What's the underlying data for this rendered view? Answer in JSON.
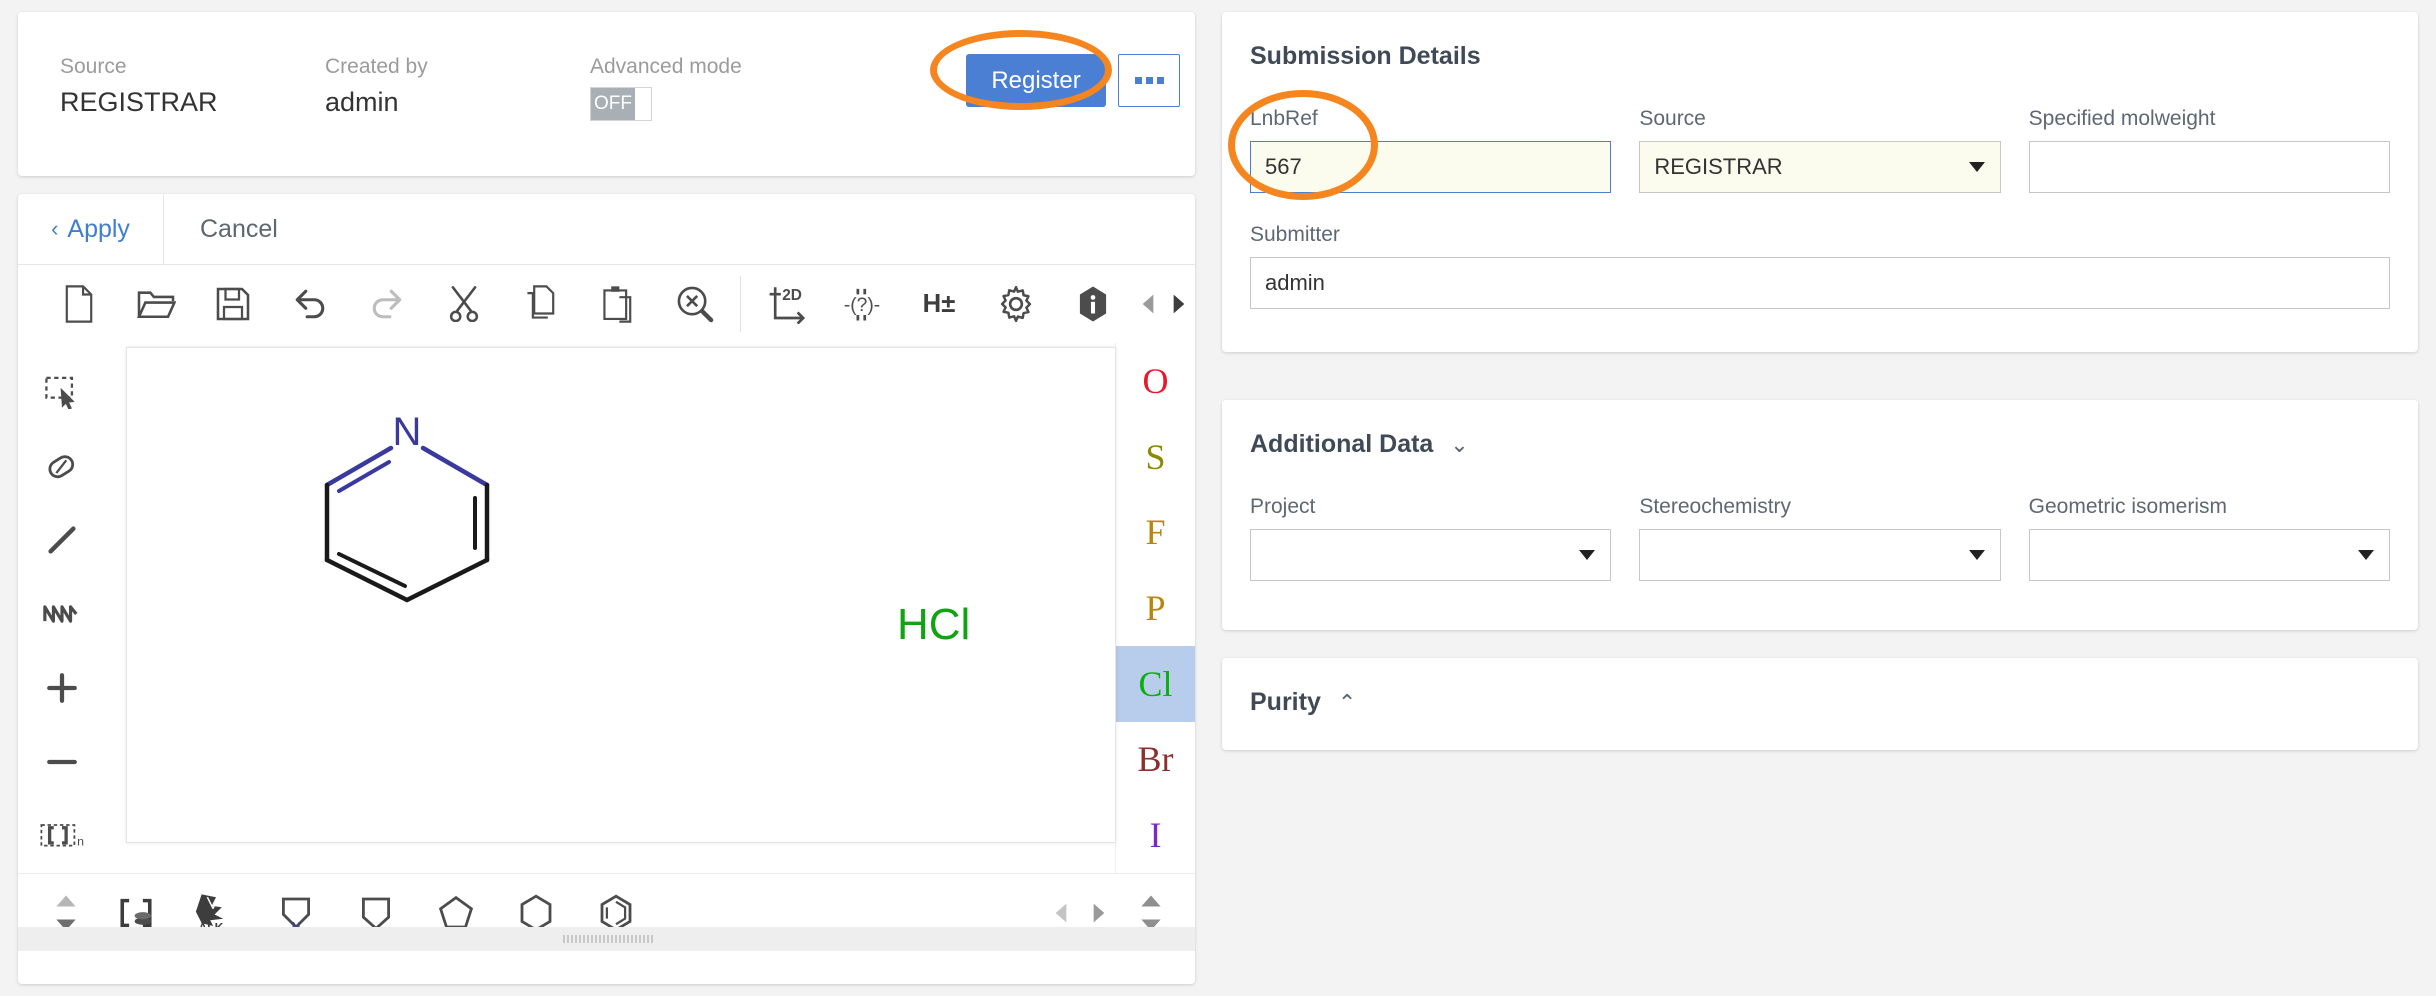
{
  "header": {
    "fields": [
      {
        "label": "Source",
        "value": "REGISTRAR"
      },
      {
        "label": "Created by",
        "value": "admin"
      },
      {
        "label": "Advanced mode",
        "value": "OFF"
      }
    ],
    "register_label": "Register",
    "more_label": "..."
  },
  "editor": {
    "apply_label": "Apply",
    "apply_chevron": "‹",
    "cancel_label": "Cancel",
    "toolbar": [
      {
        "name": "new-file-icon",
        "title": "New"
      },
      {
        "name": "open-folder-icon",
        "title": "Open"
      },
      {
        "name": "save-icon",
        "title": "Save"
      },
      {
        "name": "undo-icon",
        "title": "Undo"
      },
      {
        "name": "redo-icon",
        "title": "Redo"
      },
      {
        "name": "cut-icon",
        "title": "Cut"
      },
      {
        "name": "copy-icon",
        "title": "Copy"
      },
      {
        "name": "paste-icon",
        "title": "Paste"
      },
      {
        "name": "clean-zoom-icon",
        "title": "Clear"
      },
      {
        "name": "clean-2d-icon",
        "title": "Clean 2D"
      },
      {
        "name": "query-properties-icon",
        "title": "Query properties"
      },
      {
        "name": "hydrogen-toggle-icon",
        "title": "Add/Remove explicit hydrogens"
      },
      {
        "name": "settings-gear-icon",
        "title": "Settings"
      },
      {
        "name": "info-icon",
        "title": "About"
      }
    ],
    "toolbar_labels": {
      "clean_2d": "2D",
      "query": "(?)",
      "hydrogen": "H±"
    },
    "side_tools": [
      {
        "name": "rectangle-select-icon",
        "title": "Selection"
      },
      {
        "name": "eraser-icon",
        "title": "Erase"
      },
      {
        "name": "single-bond-icon",
        "title": "Single bond"
      },
      {
        "name": "chain-icon",
        "title": "Chain"
      },
      {
        "name": "increase-charge-icon",
        "title": "Increase charge"
      },
      {
        "name": "decrease-charge-icon",
        "title": "Decrease charge"
      },
      {
        "name": "repeating-unit-icon",
        "title": "Repeating unit"
      }
    ],
    "atom_palette": [
      {
        "symbol": "O",
        "color": "#e8192c",
        "selected": false
      },
      {
        "symbol": "S",
        "color": "#8a8a00",
        "selected": false
      },
      {
        "symbol": "F",
        "color": "#b8860b",
        "selected": false
      },
      {
        "symbol": "P",
        "color": "#b8860b",
        "selected": false
      },
      {
        "symbol": "Cl",
        "color": "#0ab00a",
        "selected": true
      },
      {
        "symbol": "Br",
        "color": "#8b2f2f",
        "selected": false
      },
      {
        "symbol": "I",
        "color": "#7d26cd",
        "selected": false
      }
    ],
    "bottom_tools": [
      {
        "name": "bracket-group-icon",
        "title": "Group"
      },
      {
        "name": "alkyl-groups-icon",
        "title": "ALK...",
        "label": "ALK..."
      },
      {
        "name": "pyrrolidine-template-icon",
        "title": "N-ring"
      },
      {
        "name": "cyclopentane-template-icon",
        "title": "Cyclopentane"
      },
      {
        "name": "pentagon-template-icon",
        "title": "Pentagon"
      },
      {
        "name": "cyclohexane-template-icon",
        "title": "Cyclohexane"
      },
      {
        "name": "benzene-template-icon",
        "title": "Benzene"
      }
    ],
    "structure": {
      "ring_label": "N",
      "ring_label_color": "#3a3a9e",
      "salt_label": "HCl",
      "salt_label_color": "#11a311"
    }
  },
  "submission": {
    "title": "Submission Details",
    "lnbref": {
      "label": "LnbRef",
      "value": "567",
      "placeholder": ""
    },
    "source": {
      "label": "Source",
      "value": "REGISTRAR"
    },
    "molweight": {
      "label": "Specified molweight",
      "value": "",
      "placeholder": ""
    },
    "submitter": {
      "label": "Submitter",
      "value": "admin",
      "placeholder": ""
    }
  },
  "additional": {
    "title": "Additional Data",
    "caret": "⌄",
    "project": {
      "label": "Project",
      "value": ""
    },
    "stereochemistry": {
      "label": "Stereochemistry",
      "value": ""
    },
    "geometric": {
      "label": "Geometric isomerism",
      "value": ""
    }
  },
  "purity": {
    "title": "Purity",
    "caret": "⌃"
  },
  "colors": {
    "accent": "#4a7fd4",
    "annotation": "#f5861f",
    "selected_atom_bg": "#b8cdeb"
  }
}
